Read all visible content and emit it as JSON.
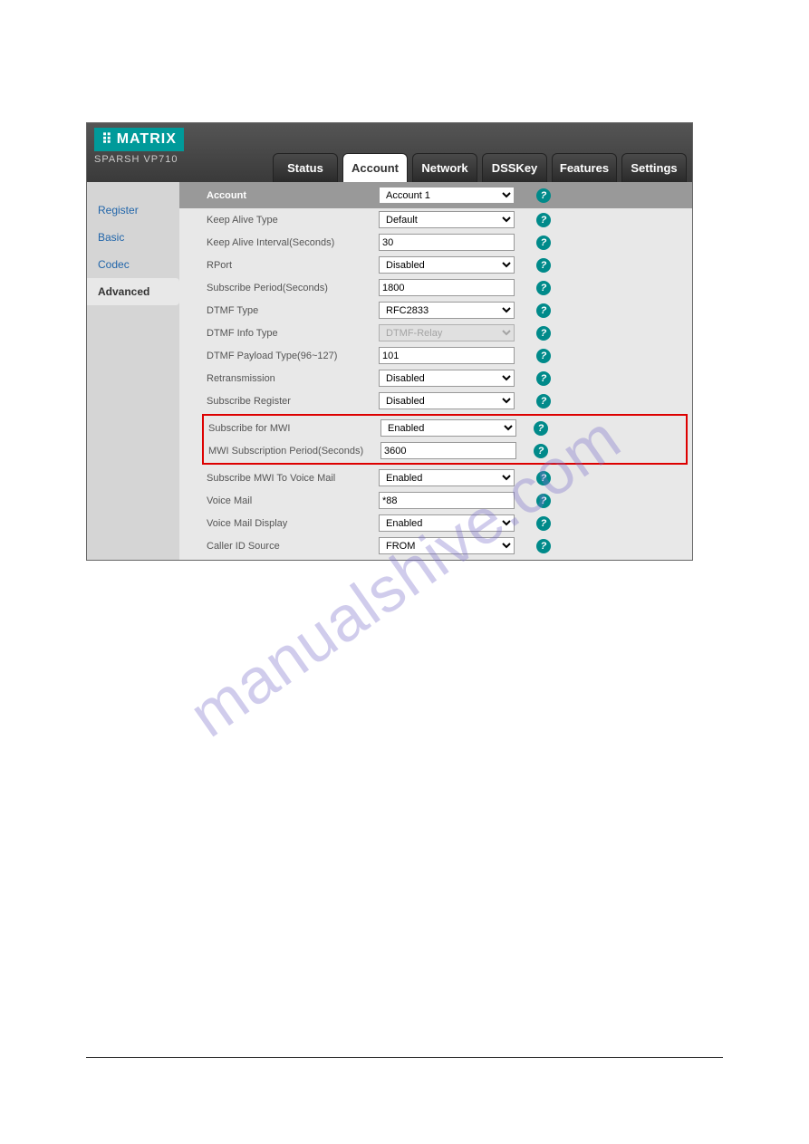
{
  "watermark": "manualshive.com",
  "brand": {
    "logo": "MATRIX",
    "product": "SPARSH VP710"
  },
  "tabs": {
    "status": "Status",
    "account": "Account",
    "network": "Network",
    "dsskey": "DSSKey",
    "features": "Features",
    "settings": "Settings"
  },
  "sidebar": {
    "register": "Register",
    "basic": "Basic",
    "codec": "Codec",
    "advanced": "Advanced"
  },
  "rows": {
    "account": {
      "label": "Account",
      "value": "Account 1"
    },
    "keepalive_type": {
      "label": "Keep Alive Type",
      "value": "Default"
    },
    "keepalive_interval": {
      "label": "Keep Alive Interval(Seconds)",
      "value": "30"
    },
    "rport": {
      "label": "RPort",
      "value": "Disabled"
    },
    "subscribe_period": {
      "label": "Subscribe Period(Seconds)",
      "value": "1800"
    },
    "dtmf_type": {
      "label": "DTMF Type",
      "value": "RFC2833"
    },
    "dtmf_info_type": {
      "label": "DTMF Info Type",
      "value": "DTMF-Relay"
    },
    "dtmf_payload": {
      "label": "DTMF Payload Type(96~127)",
      "value": "101"
    },
    "retransmission": {
      "label": "Retransmission",
      "value": "Disabled"
    },
    "subscribe_register": {
      "label": "Subscribe Register",
      "value": "Disabled"
    },
    "subscribe_mwi": {
      "label": "Subscribe for MWI",
      "value": "Enabled"
    },
    "mwi_period": {
      "label": "MWI Subscription Period(Seconds)",
      "value": "3600"
    },
    "subscribe_mwi_vm": {
      "label": "Subscribe MWI To Voice Mail",
      "value": "Enabled"
    },
    "voice_mail": {
      "label": "Voice Mail",
      "value": "*88"
    },
    "voice_mail_display": {
      "label": "Voice Mail Display",
      "value": "Enabled"
    },
    "caller_id_source": {
      "label": "Caller ID Source",
      "value": "FROM"
    }
  },
  "help_symbol": "?"
}
